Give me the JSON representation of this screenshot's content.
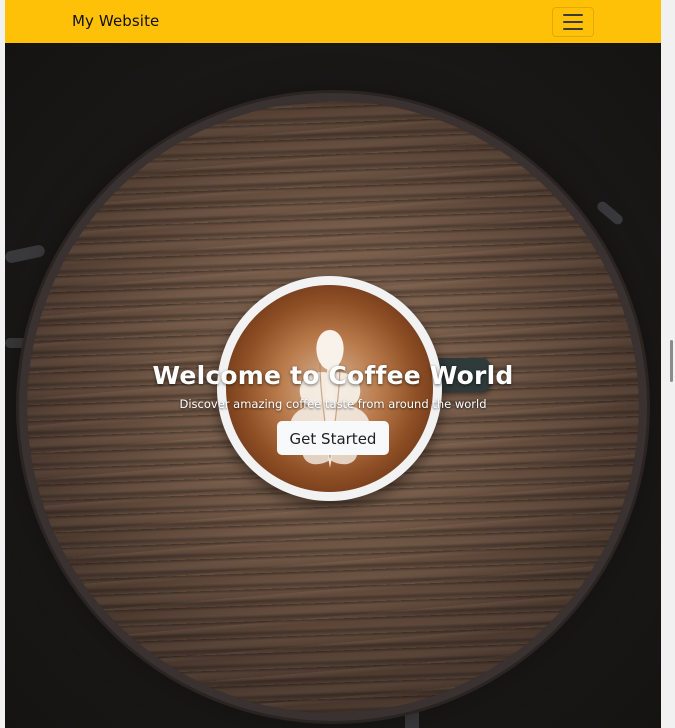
{
  "navbar": {
    "brand": "My Website",
    "toggler_icon": "hamburger-menu-icon",
    "bg_color": "#ffc107"
  },
  "hero": {
    "title": "Welcome to Coffee World",
    "subtitle": "Discover amazing coffee taste from around the world",
    "button_label": "Get Started"
  }
}
